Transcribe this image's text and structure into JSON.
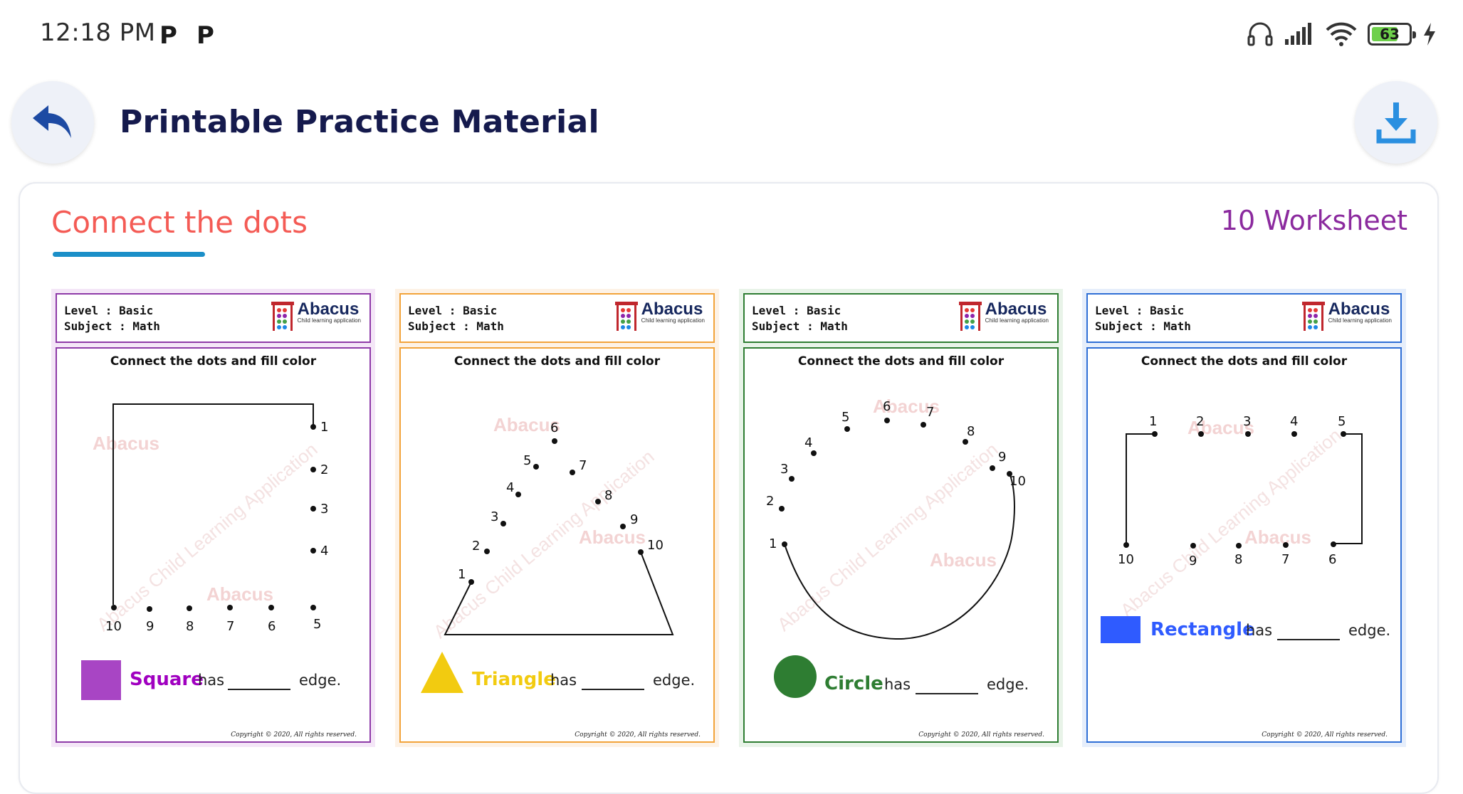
{
  "status_bar": {
    "time": "12:18 PM",
    "notif_icon_1": "P",
    "notif_icon_2": "P",
    "battery": "63"
  },
  "header": {
    "title": "Printable Practice Material",
    "back_icon": "back-arrow-icon",
    "download_icon": "download-icon"
  },
  "section": {
    "title": "Connect the dots",
    "count_label": "10 Worksheet",
    "accent_color": "#f45b55",
    "count_color": "#8b2a9e",
    "underline_color": "#1b8fc8"
  },
  "worksheets": [
    {
      "level": "Level : Basic",
      "subject": "Subject : Math",
      "logo_title": "Abacus",
      "logo_sub": "Child learning application",
      "instruction": "Connect the dots and fill color",
      "shape_name": "Square",
      "shape_color": "#a845c4",
      "has": "has",
      "edge": "edge.",
      "copyright": "Copyright © 2020, All rights reserved.",
      "frame_color": "#8e3aa8",
      "labels": [
        "1",
        "2",
        "3",
        "4",
        "5",
        "6",
        "7",
        "8",
        "9",
        "10"
      ]
    },
    {
      "level": "Level : Basic",
      "subject": "Subject : Math",
      "logo_title": "Abacus",
      "logo_sub": "Child learning application",
      "instruction": "Connect the dots and fill color",
      "shape_name": "Triangle",
      "shape_color": "#f2cb10",
      "has": "has",
      "edge": "edge.",
      "copyright": "Copyright © 2020, All rights reserved.",
      "frame_color": "#f2a33a",
      "labels": [
        "1",
        "2",
        "3",
        "4",
        "5",
        "6",
        "7",
        "8",
        "9",
        "10"
      ]
    },
    {
      "level": "Level : Basic",
      "subject": "Subject : Math",
      "logo_title": "Abacus",
      "logo_sub": "Child learning application",
      "instruction": "Connect the dots and fill color",
      "shape_name": "Circle",
      "shape_color": "#2e7d32",
      "has": "has",
      "edge": "edge.",
      "copyright": "Copyright © 2020, All rights reserved.",
      "frame_color": "#2e7d32",
      "labels": [
        "1",
        "2",
        "3",
        "4",
        "5",
        "6",
        "7",
        "8",
        "9",
        "10"
      ]
    },
    {
      "level": "Level : Basic",
      "subject": "Subject : Math",
      "logo_title": "Abacus",
      "logo_sub": "Child learning application",
      "instruction": "Connect the dots and fill color",
      "shape_name": "Rectangle",
      "shape_color": "#2f5bff",
      "has": "has",
      "edge": "edge.",
      "copyright": "Copyright © 2020, All rights reserved.",
      "frame_color": "#2f6fd6",
      "labels": [
        "1",
        "2",
        "3",
        "4",
        "5",
        "6",
        "7",
        "8",
        "9",
        "10"
      ]
    }
  ],
  "watermark": {
    "logo": "Abacus",
    "diagonal": "Abacus Child Learning Application"
  }
}
